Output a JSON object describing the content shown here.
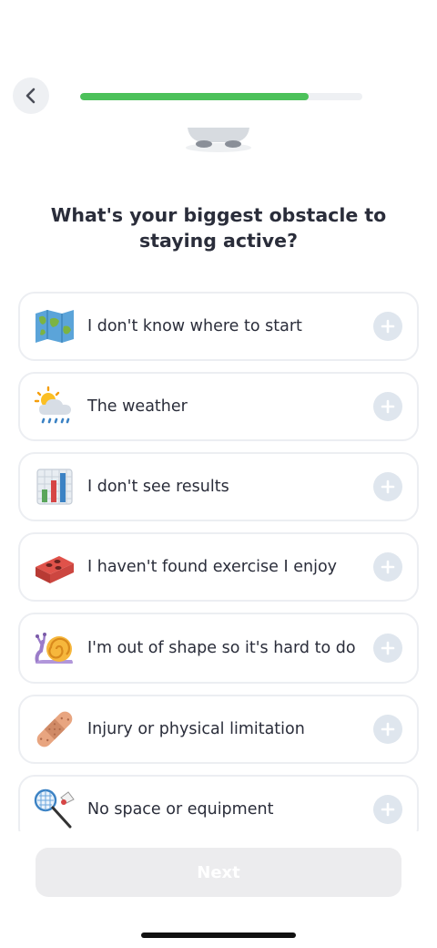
{
  "progress": {
    "fraction": 0.81
  },
  "question": "What's your biggest obstacle to staying active?",
  "options": [
    {
      "label": "I don't know where to start",
      "icon": "world-map-icon"
    },
    {
      "label": "The weather",
      "icon": "sun-behind-rain-cloud-icon"
    },
    {
      "label": "I don't see results",
      "icon": "bar-chart-icon"
    },
    {
      "label": "I haven't found exercise I enjoy",
      "icon": "brick-icon"
    },
    {
      "label": "I'm out of shape so it's hard to do",
      "icon": "snail-icon"
    },
    {
      "label": "Injury or physical limitation",
      "icon": "bandage-icon"
    },
    {
      "label": "No space or equipment",
      "icon": "badminton-icon"
    }
  ],
  "next_label": "Next",
  "colors": {
    "progress": "#4cc15a",
    "track": "#eef0f3",
    "plus_bg": "#dfe6ee",
    "border": "#eceef2",
    "disabled_button": "#ececee"
  }
}
